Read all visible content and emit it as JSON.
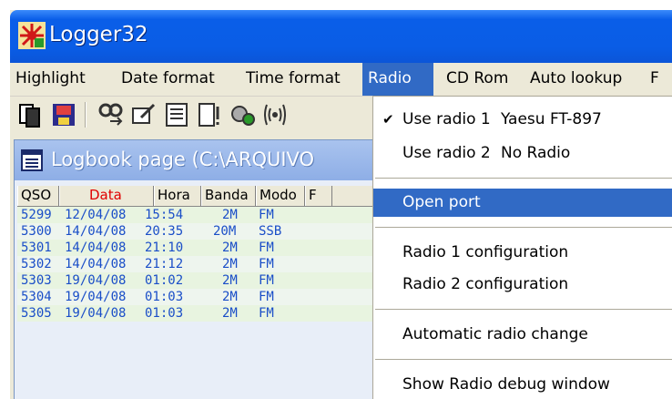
{
  "window": {
    "title": "Logger32"
  },
  "menubar": {
    "items": [
      {
        "label": "Highlight"
      },
      {
        "label": "Date format"
      },
      {
        "label": "Time format"
      },
      {
        "label": "Radio"
      },
      {
        "label": "CD Rom"
      },
      {
        "label": "Auto lookup"
      },
      {
        "label": "F"
      }
    ]
  },
  "logbook": {
    "title": "Logbook page (C:\\ARQUIVO",
    "columns": [
      "QSO",
      "Data",
      "Hora",
      "Banda",
      "Modo",
      "F"
    ],
    "rows": [
      {
        "qso": "5299",
        "data": "12/04/08",
        "hora": "15:54",
        "banda": "2M",
        "modo": "FM"
      },
      {
        "qso": "5300",
        "data": "14/04/08",
        "hora": "20:35",
        "banda": "20M",
        "modo": "SSB"
      },
      {
        "qso": "5301",
        "data": "14/04/08",
        "hora": "21:10",
        "banda": "2M",
        "modo": "FM"
      },
      {
        "qso": "5302",
        "data": "14/04/08",
        "hora": "21:12",
        "banda": "2M",
        "modo": "FM"
      },
      {
        "qso": "5303",
        "data": "19/04/08",
        "hora": "01:02",
        "banda": "2M",
        "modo": "FM"
      },
      {
        "qso": "5304",
        "data": "19/04/08",
        "hora": "01:03",
        "banda": "2M",
        "modo": "FM"
      },
      {
        "qso": "5305",
        "data": "19/04/08",
        "hora": "01:03",
        "banda": "2M",
        "modo": "FM"
      }
    ]
  },
  "radio_menu": {
    "use_radio_1": {
      "label": "Use radio 1",
      "value": "Yaesu FT-897",
      "checked": true
    },
    "use_radio_2": {
      "label": "Use radio 2",
      "value": "No Radio",
      "checked": false
    },
    "open_port": "Open port",
    "radio_1_config": "Radio 1 configuration",
    "radio_2_config": "Radio 2 configuration",
    "automatic_change": "Automatic radio change",
    "debug_window": "Show Radio debug window",
    "check_glyph": "✔"
  },
  "colors": {
    "title_blue": "#0a5ee8",
    "menu_highlight": "#316ac5",
    "row_text": "#1a4ec8",
    "data_header": "#e00000"
  }
}
